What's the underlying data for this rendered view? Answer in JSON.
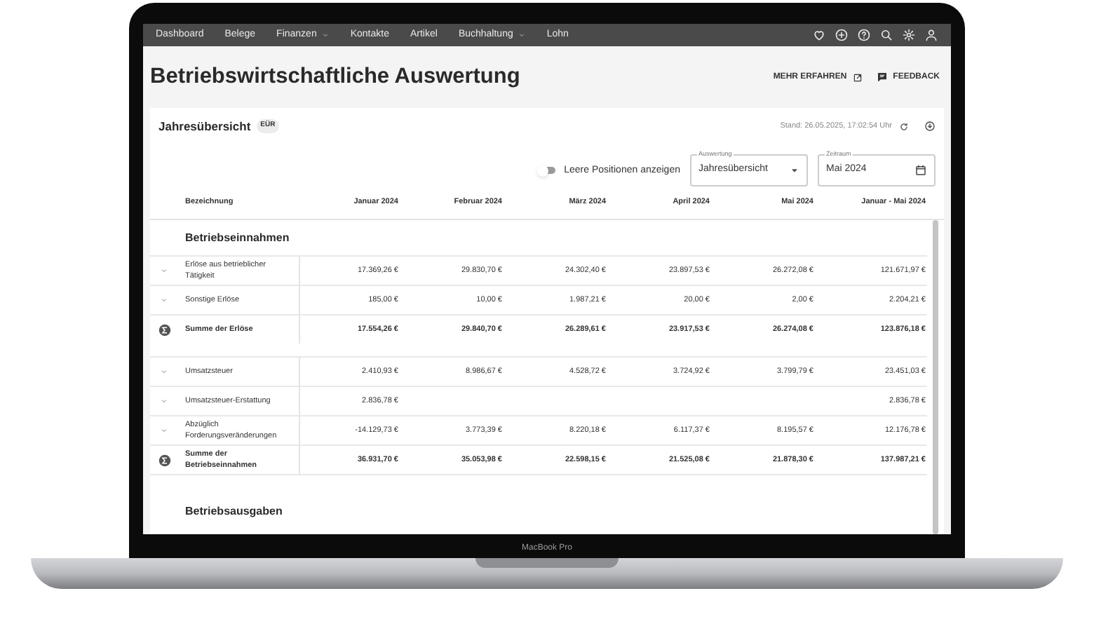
{
  "nav": {
    "items": [
      {
        "label": "Dashboard",
        "dropdown": false
      },
      {
        "label": "Belege",
        "dropdown": false
      },
      {
        "label": "Finanzen",
        "dropdown": true
      },
      {
        "label": "Kontakte",
        "dropdown": false
      },
      {
        "label": "Artikel",
        "dropdown": false
      },
      {
        "label": "Buchhaltung",
        "dropdown": true
      },
      {
        "label": "Lohn",
        "dropdown": false
      }
    ]
  },
  "header": {
    "title": "Betriebswirtschaftliche Auswertung",
    "links": [
      {
        "label": "MEHR ERFAHREN",
        "kind": "external"
      },
      {
        "label": "FEEDBACK",
        "kind": "feedback"
      }
    ]
  },
  "card": {
    "title": "Jahresübersicht",
    "badge": "EÜR",
    "timestamp": "Stand: 26.05.2025, 17:02:54 Uhr",
    "toggle": {
      "label": "Leere Positionen anzeigen",
      "on": false
    },
    "fields": [
      {
        "label": "Auswertung",
        "value": "Jahresübersicht",
        "kind": "select"
      },
      {
        "label": "Zeitraum",
        "value": "Mai 2024",
        "kind": "date"
      }
    ]
  },
  "table": {
    "columns": [
      "Bezeichnung",
      "Januar 2024",
      "Februar 2024",
      "März 2024",
      "April 2024",
      "Mai 2024",
      "Januar - Mai 2024"
    ],
    "sections": [
      {
        "title": "Betriebseinnahmen",
        "groups": [
          {
            "rows": [
              {
                "kind": "item",
                "label": "Erlöse aus betrieblicher Tätigkeit",
                "values": [
                  "17.369,26 €",
                  "29.830,70 €",
                  "24.302,40 €",
                  "23.897,53 €",
                  "26.272,08 €",
                  "121.671,97 €"
                ]
              },
              {
                "kind": "item",
                "label": "Sonstige Erlöse",
                "values": [
                  "185,00 €",
                  "10,00 €",
                  "1.987,21 €",
                  "20,00 €",
                  "2,00 €",
                  "2.204,21 €"
                ]
              },
              {
                "kind": "sum",
                "label": "Summe der Erlöse",
                "values": [
                  "17.554,26 €",
                  "29.840,70 €",
                  "26.289,61 €",
                  "23.917,53 €",
                  "26.274,08 €",
                  "123.876,18 €"
                ]
              }
            ]
          },
          {
            "rows": [
              {
                "kind": "item",
                "label": "Umsatzsteuer",
                "values": [
                  "2.410,93 €",
                  "8.986,67 €",
                  "4.528,72 €",
                  "3.724,92 €",
                  "3.799,79 €",
                  "23.451,03 €"
                ]
              },
              {
                "kind": "item",
                "label": "Umsatzsteuer-Erstattung",
                "cells": [
                  {
                    "kind": "amount",
                    "text": "2.836,78 €"
                  },
                  {
                    "kind": "blank"
                  },
                  {
                    "kind": "blank"
                  },
                  {
                    "kind": "blank"
                  },
                  {
                    "kind": "blank"
                  },
                  {
                    "kind": "amount",
                    "text": "2.836,78 €"
                  }
                ]
              },
              {
                "kind": "item",
                "label": "Abzüglich Forderungsveränderungen",
                "values": [
                  "-14.129,73 €",
                  "3.773,39 €",
                  "8.220,18 €",
                  "6.117,37 €",
                  "8.195,57 €",
                  "12.176,78 €"
                ]
              },
              {
                "kind": "sum",
                "label": "Summe der Betriebseinnahmen",
                "values": [
                  "36.931,70 €",
                  "35.053,98 €",
                  "22.598,15 €",
                  "21.525,08 €",
                  "21.878,30 €",
                  "137.987,21 €"
                ]
              }
            ]
          }
        ]
      },
      {
        "title": "Betriebsausgaben"
      }
    ]
  },
  "device": {
    "label": "MacBook Pro"
  }
}
